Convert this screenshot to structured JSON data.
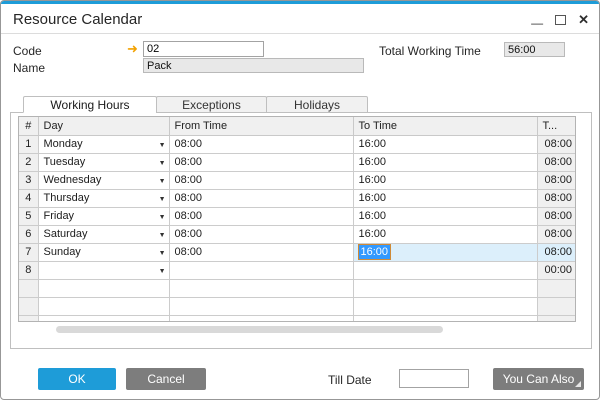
{
  "window": {
    "title": "Resource Calendar"
  },
  "icons": {
    "link_arrow": "➜",
    "dropdown": "▼",
    "minimize": "—",
    "close": "✕"
  },
  "form": {
    "code": {
      "label": "Code",
      "value": "02"
    },
    "name": {
      "label": "Name",
      "value": "Pack"
    },
    "total_working_time": {
      "label": "Total Working Time",
      "value": "56:00"
    }
  },
  "tabs": [
    {
      "label": "Working Hours",
      "active": true
    },
    {
      "label": "Exceptions",
      "active": false
    },
    {
      "label": "Holidays",
      "active": false
    }
  ],
  "table": {
    "columns": [
      "#",
      "Day",
      "From Time",
      "To Time",
      "T..."
    ],
    "rows": [
      {
        "num": "1",
        "day": "Monday",
        "from": "08:00",
        "to": "16:00",
        "total": "08:00"
      },
      {
        "num": "2",
        "day": "Tuesday",
        "from": "08:00",
        "to": "16:00",
        "total": "08:00"
      },
      {
        "num": "3",
        "day": "Wednesday",
        "from": "08:00",
        "to": "16:00",
        "total": "08:00"
      },
      {
        "num": "4",
        "day": "Thursday",
        "from": "08:00",
        "to": "16:00",
        "total": "08:00"
      },
      {
        "num": "5",
        "day": "Friday",
        "from": "08:00",
        "to": "16:00",
        "total": "08:00"
      },
      {
        "num": "6",
        "day": "Saturday",
        "from": "08:00",
        "to": "16:00",
        "total": "08:00"
      },
      {
        "num": "7",
        "day": "Sunday",
        "from": "08:00",
        "to": "16:00",
        "total": "08:00",
        "selected_cell": "to"
      },
      {
        "num": "8",
        "day": "",
        "from": "",
        "to": "",
        "total": "00:00"
      }
    ],
    "empty_rows": 3
  },
  "footer": {
    "ok": "OK",
    "cancel": "Cancel",
    "till_date_label": "Till Date",
    "till_date_value": "",
    "you_can_also": "You Can Also"
  },
  "colors": {
    "accent_blue": "#1E9CD8",
    "selection_blue": "#3399FF",
    "selection_border_orange": "#CF8A37",
    "arrow_orange": "#F2A100",
    "active_cell_blue": "#DCEFFB",
    "header_gray": "#F0F0F0",
    "button_gray": "#7D7D7D"
  }
}
